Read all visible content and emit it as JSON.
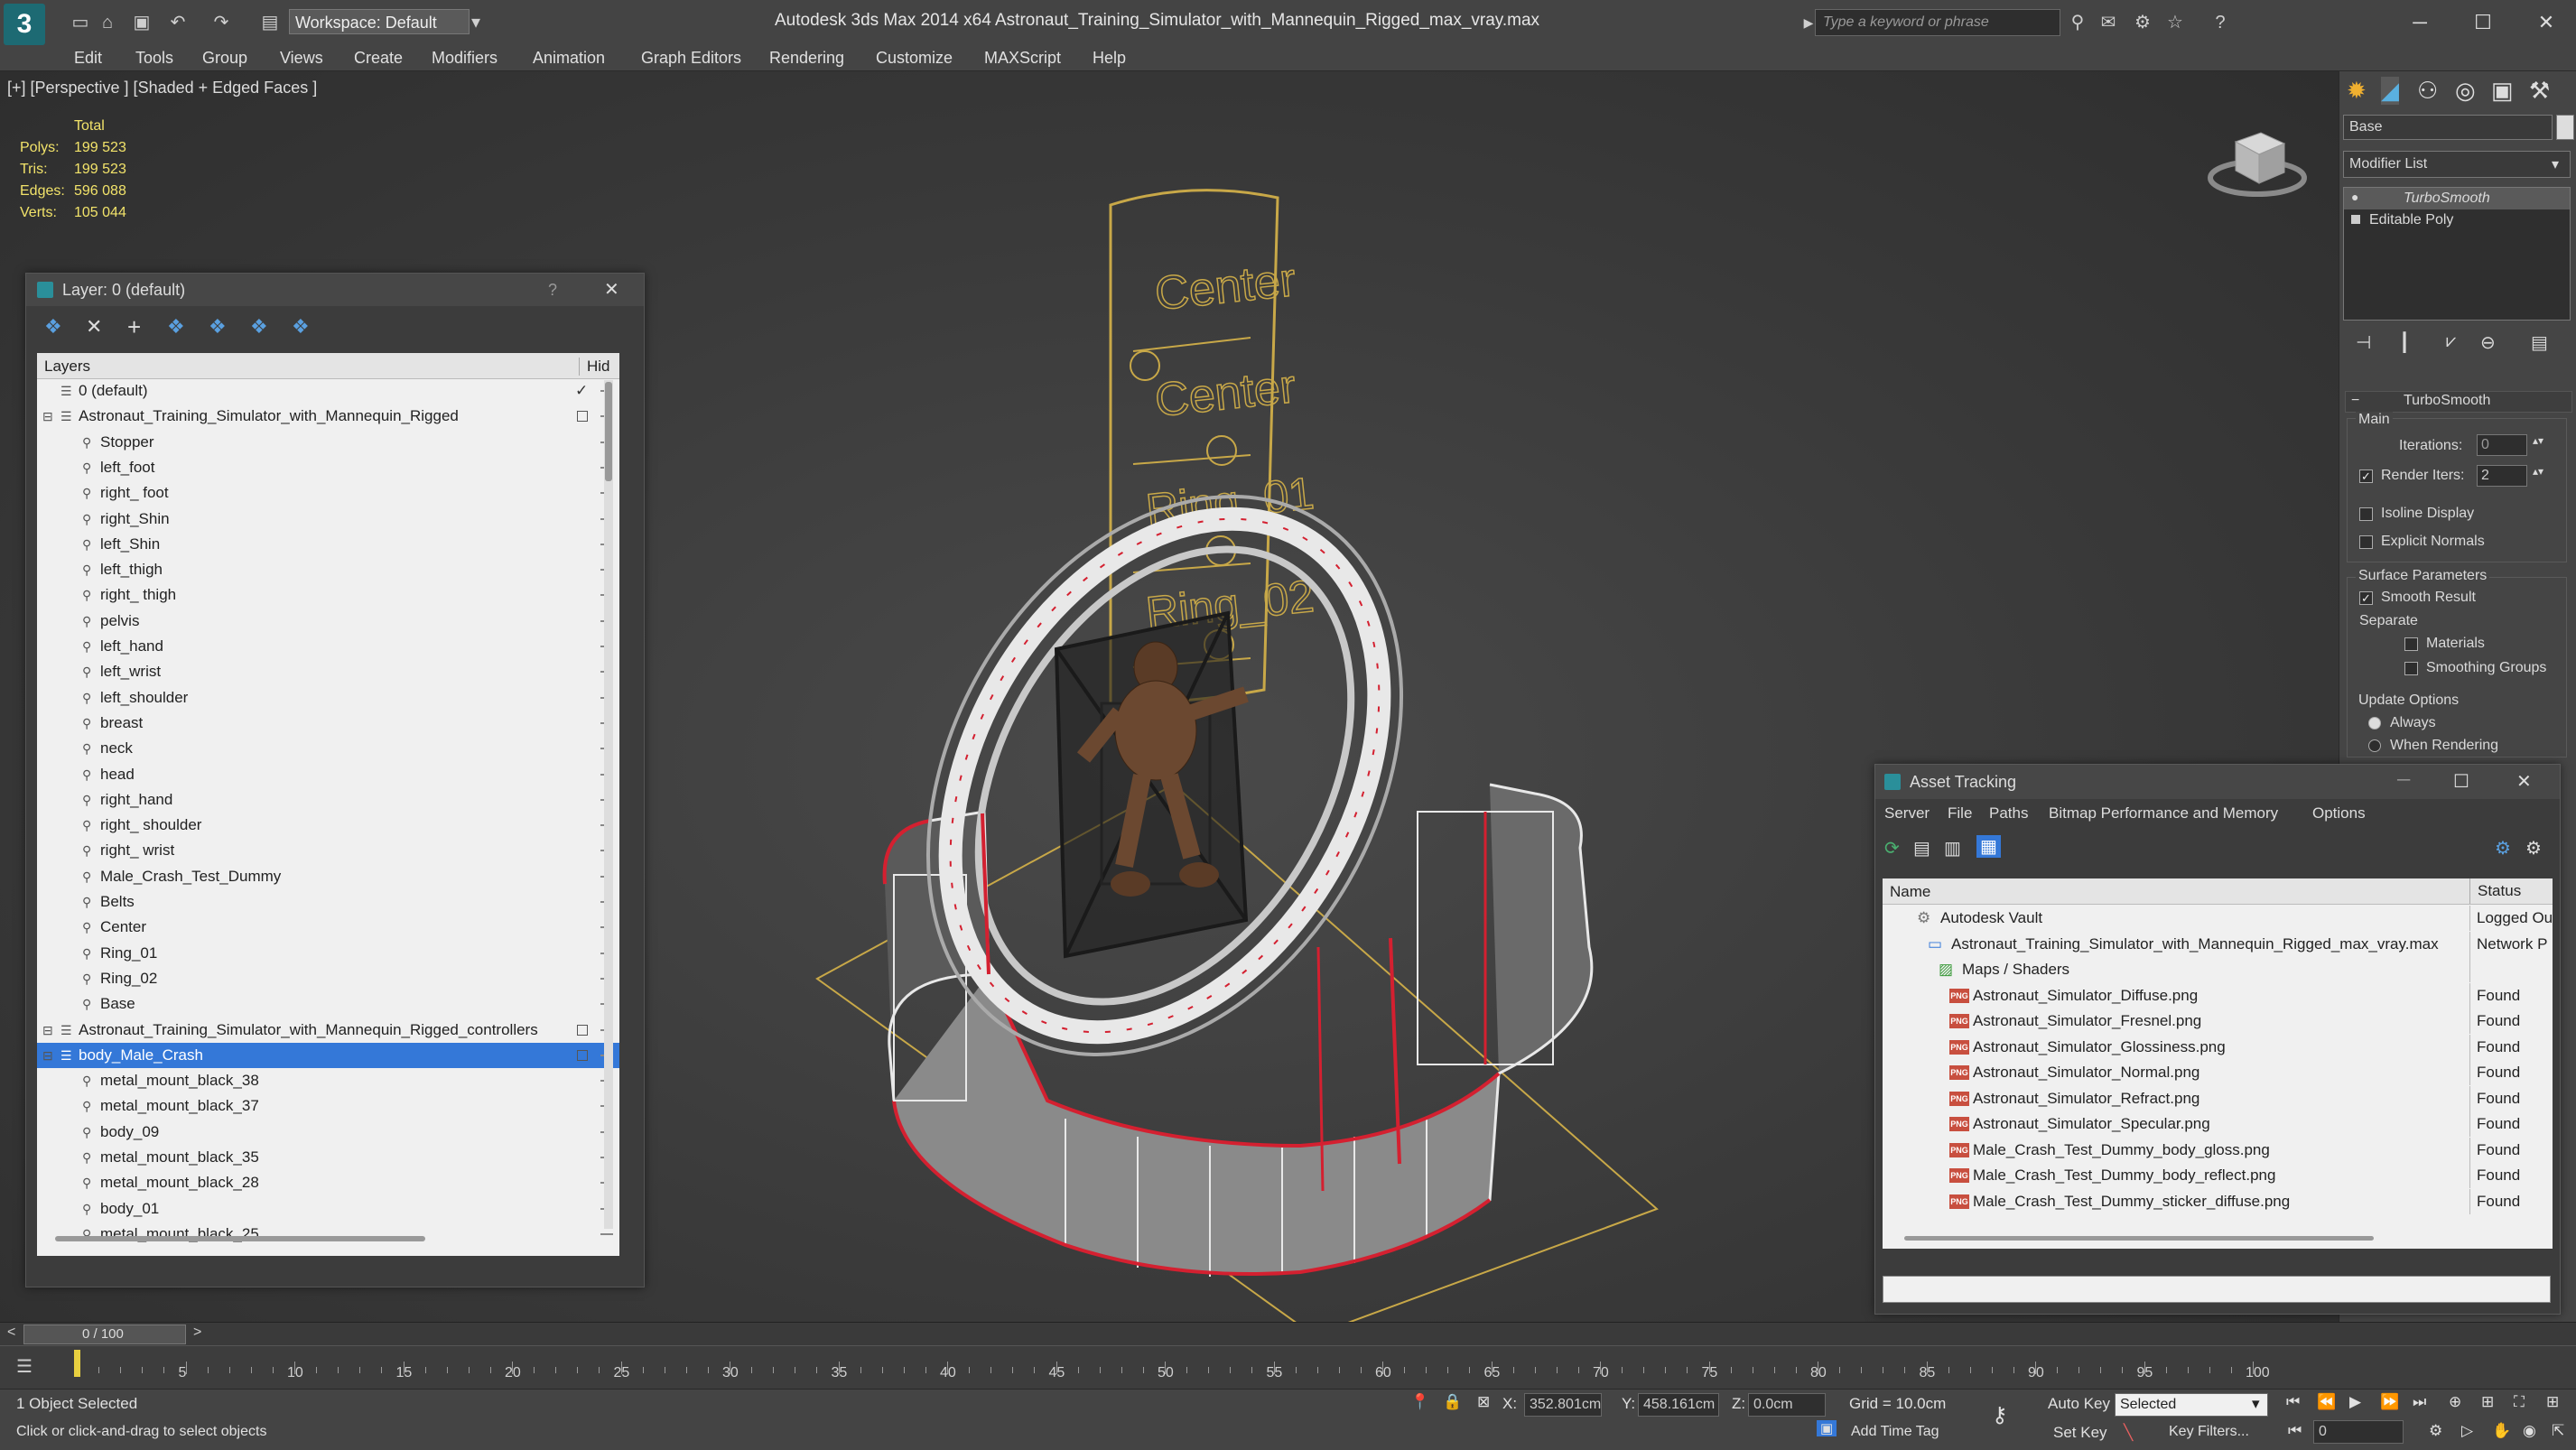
{
  "app": {
    "title": "Autodesk 3ds Max  2014 x64      Astronaut_Training_Simulator_with_Mannequin_Rigged_max_vray.max",
    "logo": "3",
    "workspace": "Workspace: Default",
    "search_placeholder": "Type a keyword or phrase"
  },
  "menu": [
    "Edit",
    "Tools",
    "Group",
    "Views",
    "Create",
    "Modifiers",
    "Animation",
    "Graph Editors",
    "Rendering",
    "Customize",
    "MAXScript",
    "Help"
  ],
  "viewport": {
    "label": "[+] [Perspective ] [Shaded + Edged Faces ]",
    "stats": {
      "header": "Total",
      "rows": [
        {
          "label": "Polys:",
          "value": "199 523"
        },
        {
          "label": "Tris:",
          "value": "199 523"
        },
        {
          "label": "Edges:",
          "value": "596 088"
        },
        {
          "label": "Verts:",
          "value": "105 044"
        }
      ]
    },
    "sign_labels": [
      "Center",
      "Center",
      "Ring_01",
      "Ring_02"
    ]
  },
  "layer_panel": {
    "title": "Layer: 0 (default)",
    "help": "?",
    "col_layers": "Layers",
    "col_hide": "Hid",
    "rows": [
      {
        "name": "0 (default)",
        "level": 0,
        "type": "layer",
        "check": true
      },
      {
        "name": "Astronaut_Training_Simulator_with_Mannequin_Rigged",
        "level": 0,
        "type": "layer",
        "box": true,
        "expander": true
      },
      {
        "name": "Stopper",
        "level": 1
      },
      {
        "name": "left_foot",
        "level": 1
      },
      {
        "name": "right_ foot",
        "level": 1
      },
      {
        "name": "right_Shin",
        "level": 1
      },
      {
        "name": "left_Shin",
        "level": 1
      },
      {
        "name": "left_thigh",
        "level": 1
      },
      {
        "name": "right_ thigh",
        "level": 1
      },
      {
        "name": "pelvis",
        "level": 1
      },
      {
        "name": "left_hand",
        "level": 1
      },
      {
        "name": "left_wrist",
        "level": 1
      },
      {
        "name": "left_shoulder",
        "level": 1
      },
      {
        "name": "breast",
        "level": 1
      },
      {
        "name": "neck",
        "level": 1
      },
      {
        "name": "head",
        "level": 1
      },
      {
        "name": "right_hand",
        "level": 1
      },
      {
        "name": "right_ shoulder",
        "level": 1
      },
      {
        "name": "right_ wrist",
        "level": 1
      },
      {
        "name": "Male_Crash_Test_Dummy",
        "level": 1
      },
      {
        "name": "Belts",
        "level": 1
      },
      {
        "name": "Center",
        "level": 1
      },
      {
        "name": "Ring_01",
        "level": 1
      },
      {
        "name": "Ring_02",
        "level": 1
      },
      {
        "name": "Base",
        "level": 1
      },
      {
        "name": "Astronaut_Training_Simulator_with_Mannequin_Rigged_controllers",
        "level": 0,
        "type": "layer",
        "box": true,
        "expander": true
      },
      {
        "name": "body_Male_Crash",
        "level": 0,
        "type": "layer",
        "box": true,
        "expander": true,
        "selected": true
      },
      {
        "name": "metal_mount_black_38",
        "level": 1
      },
      {
        "name": "metal_mount_black_37",
        "level": 1
      },
      {
        "name": "body_09",
        "level": 1
      },
      {
        "name": "metal_mount_black_35",
        "level": 1
      },
      {
        "name": "metal_mount_black_28",
        "level": 1
      },
      {
        "name": "body_01",
        "level": 1
      },
      {
        "name": "metal_mount_black_25",
        "level": 1
      }
    ]
  },
  "command_panel": {
    "object_name": "Base",
    "modifier_list": "Modifier List",
    "stack": [
      {
        "name": "TurboSmooth",
        "active": true
      },
      {
        "name": "Editable Poly",
        "active": false
      }
    ],
    "rollout_title": "TurboSmooth",
    "main_label": "Main",
    "iterations_label": "Iterations:",
    "iterations_value": "0",
    "render_iters_label": "Render Iters:",
    "render_iters_value": "2",
    "render_iters_checked": true,
    "isoline_label": "Isoline Display",
    "explicit_normals_label": "Explicit Normals",
    "surface_params_label": "Surface Parameters",
    "smooth_result_label": "Smooth Result",
    "separate_label": "Separate",
    "materials_label": "Materials",
    "smoothing_groups_label": "Smoothing Groups",
    "update_options_label": "Update Options",
    "always_label": "Always",
    "when_rendering_label": "When Rendering"
  },
  "asset_tracking": {
    "title": "Asset Tracking",
    "menu": [
      "Server",
      "File",
      "Paths",
      "Bitmap Performance and Memory",
      "Options"
    ],
    "col_name": "Name",
    "col_status": "Status",
    "rows": [
      {
        "name": "Autodesk Vault",
        "status": "Logged Ou",
        "indent": 1,
        "icon": "vault"
      },
      {
        "name": "Astronaut_Training_Simulator_with_Mannequin_Rigged_max_vray.max",
        "status": "Network P",
        "indent": 2,
        "icon": "max"
      },
      {
        "name": "Maps / Shaders",
        "status": "",
        "indent": 3,
        "icon": "maps"
      },
      {
        "name": "Astronaut_Simulator_Diffuse.png",
        "status": "Found",
        "indent": 4,
        "icon": "png"
      },
      {
        "name": "Astronaut_Simulator_Fresnel.png",
        "status": "Found",
        "indent": 4,
        "icon": "png"
      },
      {
        "name": "Astronaut_Simulator_Glossiness.png",
        "status": "Found",
        "indent": 4,
        "icon": "png"
      },
      {
        "name": "Astronaut_Simulator_Normal.png",
        "status": "Found",
        "indent": 4,
        "icon": "png"
      },
      {
        "name": "Astronaut_Simulator_Refract.png",
        "status": "Found",
        "indent": 4,
        "icon": "png"
      },
      {
        "name": "Astronaut_Simulator_Specular.png",
        "status": "Found",
        "indent": 4,
        "icon": "png"
      },
      {
        "name": "Male_Crash_Test_Dummy_body_gloss.png",
        "status": "Found",
        "indent": 4,
        "icon": "png"
      },
      {
        "name": "Male_Crash_Test_Dummy_body_reflect.png",
        "status": "Found",
        "indent": 4,
        "icon": "png"
      },
      {
        "name": "Male_Crash_Test_Dummy_sticker_diffuse.png",
        "status": "Found",
        "indent": 4,
        "icon": "png"
      }
    ],
    "png_badge": "PNG"
  },
  "timeline": {
    "frame": "0 / 100",
    "prev": "<",
    "next": ">",
    "ticks": [
      "5",
      "10",
      "15",
      "20",
      "25",
      "30",
      "35",
      "40",
      "45",
      "50",
      "55",
      "60",
      "65",
      "70",
      "75",
      "80",
      "85",
      "90",
      "95",
      "100"
    ]
  },
  "status": {
    "selection": "1 Object Selected",
    "prompt": "Click or click-and-drag to select objects",
    "x_label": "X:",
    "x_value": "352.801cm",
    "y_label": "Y:",
    "y_value": "458.161cm",
    "z_label": "Z:",
    "z_value": "0.0cm",
    "grid": "Grid = 10.0cm",
    "add_time_tag": "Add Time Tag",
    "auto_key": "Auto Key",
    "set_key": "Set Key",
    "selected": "Selected",
    "key_filters": "Key Filters...",
    "frame_value": "0"
  },
  "colors": {
    "stats_text": "#f2e36a",
    "selection_blue": "#3478d8",
    "wire_white": "#e8e8e8",
    "wire_red": "#d42030",
    "wire_gold": "#c8a848"
  }
}
